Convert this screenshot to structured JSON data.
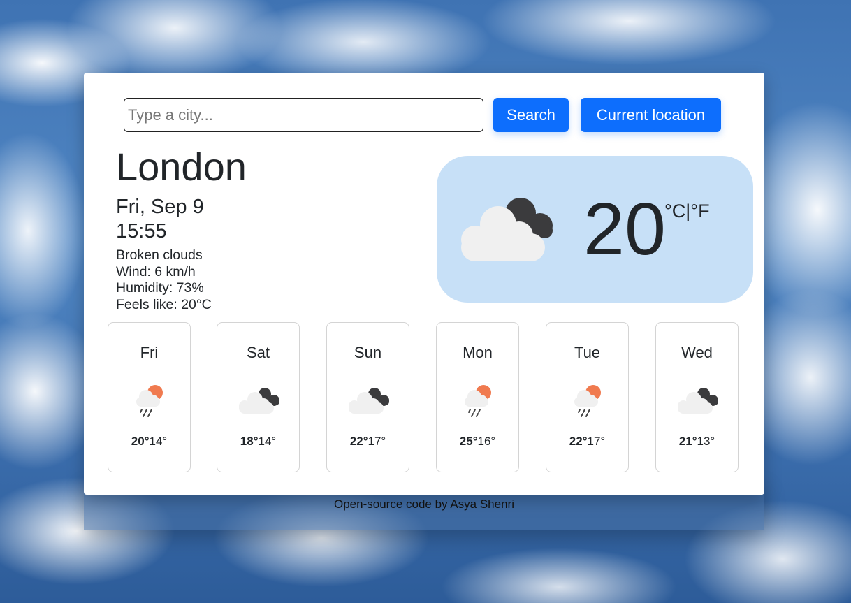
{
  "search": {
    "placeholder": "Type a city...",
    "value": "",
    "search_label": "Search",
    "location_label": "Current location"
  },
  "current": {
    "city": "London",
    "date": "Fri, Sep 9",
    "time": "15:55",
    "description": "Broken clouds",
    "wind": "Wind: 6 km/h",
    "humidity": "Humidity: 73%",
    "feels_like": "Feels like: 20°C",
    "temperature": "20",
    "units": "°C|°F",
    "icon": "broken-clouds-icon",
    "box_color": "#c7e0f7"
  },
  "forecast": [
    {
      "day": "Fri",
      "icon": "rain-sun-icon",
      "max": "20°",
      "min": "14°"
    },
    {
      "day": "Sat",
      "icon": "broken-clouds-icon",
      "max": "18°",
      "min": "14°"
    },
    {
      "day": "Sun",
      "icon": "broken-clouds-icon",
      "max": "22°",
      "min": "17°"
    },
    {
      "day": "Mon",
      "icon": "rain-sun-icon",
      "max": "25°",
      "min": "16°"
    },
    {
      "day": "Tue",
      "icon": "rain-sun-icon",
      "max": "22°",
      "min": "17°"
    },
    {
      "day": "Wed",
      "icon": "broken-clouds-icon",
      "max": "21°",
      "min": "13°"
    }
  ],
  "footer": {
    "text": "Open-source code by Asya Shenri"
  },
  "colors": {
    "accent": "#0d6efd",
    "sun": "#f07a4f",
    "dark_cloud": "#3b3b3d",
    "light_cloud": "#f0f0f0"
  }
}
